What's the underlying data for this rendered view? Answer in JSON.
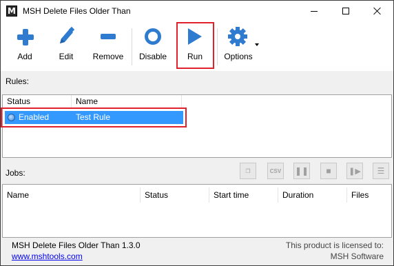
{
  "window": {
    "title": "MSH Delete Files Older Than",
    "icon_letter": "M"
  },
  "toolbar": {
    "add_label": "Add",
    "edit_label": "Edit",
    "remove_label": "Remove",
    "disable_label": "Disable",
    "run_label": "Run",
    "options_label": "Options"
  },
  "rules": {
    "label": "Rules:",
    "columns": [
      "Status",
      "Name"
    ],
    "rows": [
      {
        "status": "Enabled",
        "name": "Test Rule",
        "selected": true
      }
    ]
  },
  "jobs": {
    "label": "Jobs:",
    "csv_label": "CSV",
    "columns": [
      "Name",
      "Status",
      "Start time",
      "Duration",
      "Files"
    ],
    "rows": []
  },
  "footer": {
    "version": "MSH Delete Files Older Than 1.3.0",
    "website": "www.mshtools.com",
    "license_line1": "This product is licensed to:",
    "license_line2": "MSH Software"
  },
  "colors": {
    "accent": "#2f7bd0",
    "selection": "#3399ff",
    "annotation": "#e0202a",
    "link": "#0000ee"
  },
  "icons": [
    "plus-icon",
    "pencil-icon",
    "minus-icon",
    "ring-icon",
    "play-icon",
    "gear-icon"
  ]
}
